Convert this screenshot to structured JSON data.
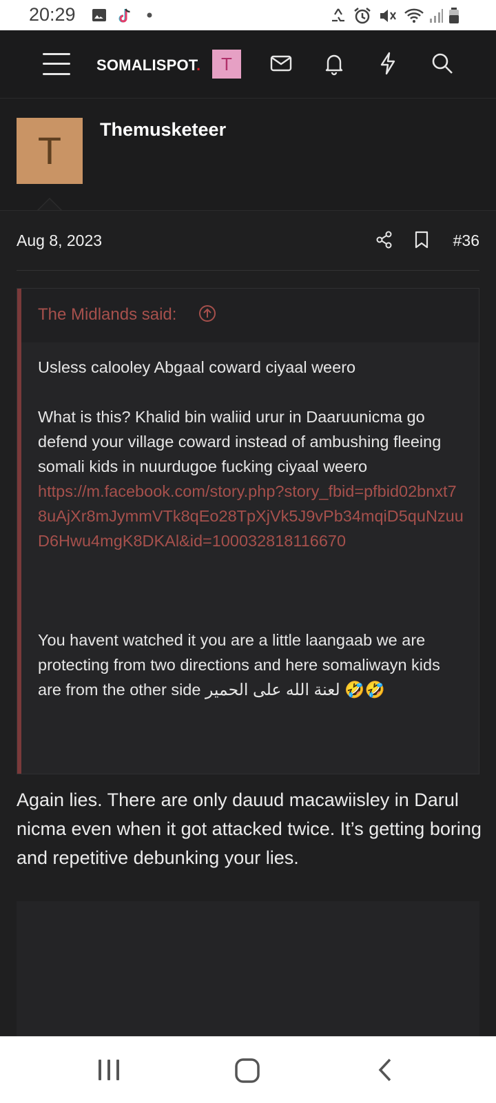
{
  "status_bar": {
    "time": "20:29",
    "icons": [
      "gallery-icon",
      "tiktok-icon",
      "dot-icon",
      "recycle-icon",
      "alarm-icon",
      "mute-icon",
      "wifi-icon",
      "signal-icon",
      "battery-icon"
    ]
  },
  "header": {
    "logo_text": "SOMALISPOT",
    "logo_dot": ".",
    "user_initial": "T",
    "icons": [
      "menu-icon",
      "inbox-icon",
      "bell-icon",
      "lightning-icon",
      "search-icon"
    ]
  },
  "post": {
    "avatar_initial": "T",
    "username": "Themusketeer",
    "date": "Aug 8, 2023",
    "number": "#36",
    "quote": {
      "title": "The Midlands said:",
      "line1": "Usless calooley Abgaal coward ciyaal weero",
      "para2": "What is this? Khalid bin waliid urur in Daaruunicma go defend your village coward instead of ambushing fleeing somali kids in nuurdugoe fucking ciyaal weero",
      "link": "https://m.facebook.com/story.php?story_fbid=pfbid02bnxt78uAjXr8mJymmVTk8qEo28TpXjVk5J9vPb34mqiD5quNzuuD6Hwu4mgK8DKAl&id=100032818116670",
      "para3": "You havent watched it you are a little laangaab we are protecting from two directions and here somaliwayn kids are from the other side لعنة الله على الحمير 🤣🤣"
    },
    "reply": "Again lies. There are only dauud macawiisley in Darul nicma even when it got attacked twice. It’s getting boring and repetitive debunking your lies."
  },
  "colors": {
    "accent": "#a6504c",
    "background": "#1f1f20",
    "logo_dot": "#d91f26"
  }
}
